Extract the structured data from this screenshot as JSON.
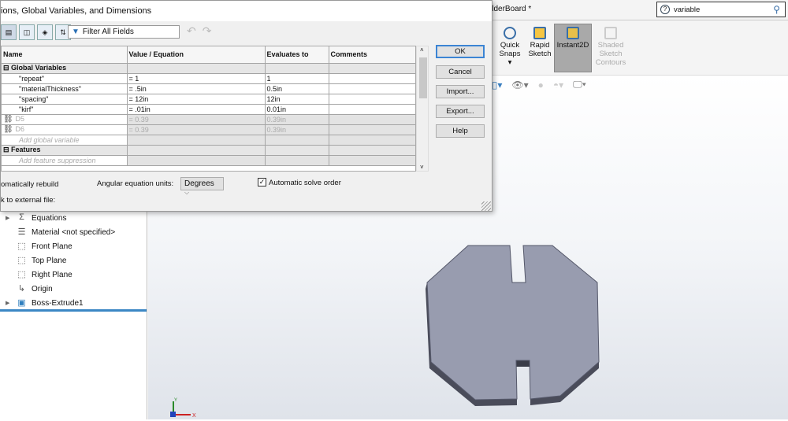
{
  "app": {
    "title": "ilderBoard *",
    "search_value": "variable",
    "ribbon": [
      {
        "label": "Quick Snaps"
      },
      {
        "label": "Rapid Sketch"
      },
      {
        "label": "Instant2D"
      },
      {
        "label": "Shaded Sketch Contours"
      }
    ]
  },
  "tree": {
    "items": [
      {
        "label": "Equations",
        "icon": "sigma-icon",
        "expandable": true
      },
      {
        "label": "Material <not specified>",
        "icon": "material-icon",
        "expandable": false
      },
      {
        "label": "Front Plane",
        "icon": "plane-icon",
        "expandable": false
      },
      {
        "label": "Top Plane",
        "icon": "plane-icon",
        "expandable": false
      },
      {
        "label": "Right Plane",
        "icon": "plane-icon",
        "expandable": false
      },
      {
        "label": "Origin",
        "icon": "origin-icon",
        "expandable": false
      },
      {
        "label": "Boss-Extrude1",
        "icon": "extrude-icon",
        "expandable": true
      }
    ]
  },
  "dialog": {
    "title": "ions, Global Variables, and Dimensions",
    "filter_placeholder": "Filter All Fields",
    "columns": [
      "Name",
      "Value / Equation",
      "Evaluates to",
      "Comments"
    ],
    "sections": {
      "global": "Global Variables",
      "features": "Features"
    },
    "rows": [
      {
        "name": "\"repeat\"",
        "value": "= 1",
        "evaluates": "1"
      },
      {
        "name": "\"materialThickness\"",
        "value": "= .5in",
        "evaluates": "0.5in"
      },
      {
        "name": "\"spacing\"",
        "value": "= 12in",
        "evaluates": "12in"
      },
      {
        "name": "\"kirf\"",
        "value": "= .01in",
        "evaluates": "0.01in"
      },
      {
        "name": "D5",
        "value": "= 0.39",
        "evaluates": "0.39in"
      },
      {
        "name": "D6",
        "value": "= 0.39",
        "evaluates": "0.39in"
      }
    ],
    "add_global": "Add global variable",
    "add_feature": "Add feature suppression",
    "buttons": {
      "ok": "OK",
      "cancel": "Cancel",
      "import": "Import...",
      "export": "Export...",
      "help": "Help"
    },
    "auto_rebuild": "omatically rebuild",
    "angular_label": "Angular equation units:",
    "angular_value": "Degrees",
    "auto_solve": "Automatic solve order",
    "auto_solve_checked": true,
    "link_external": "k to external file:"
  },
  "axes": {
    "x": "X",
    "y": "Y"
  }
}
